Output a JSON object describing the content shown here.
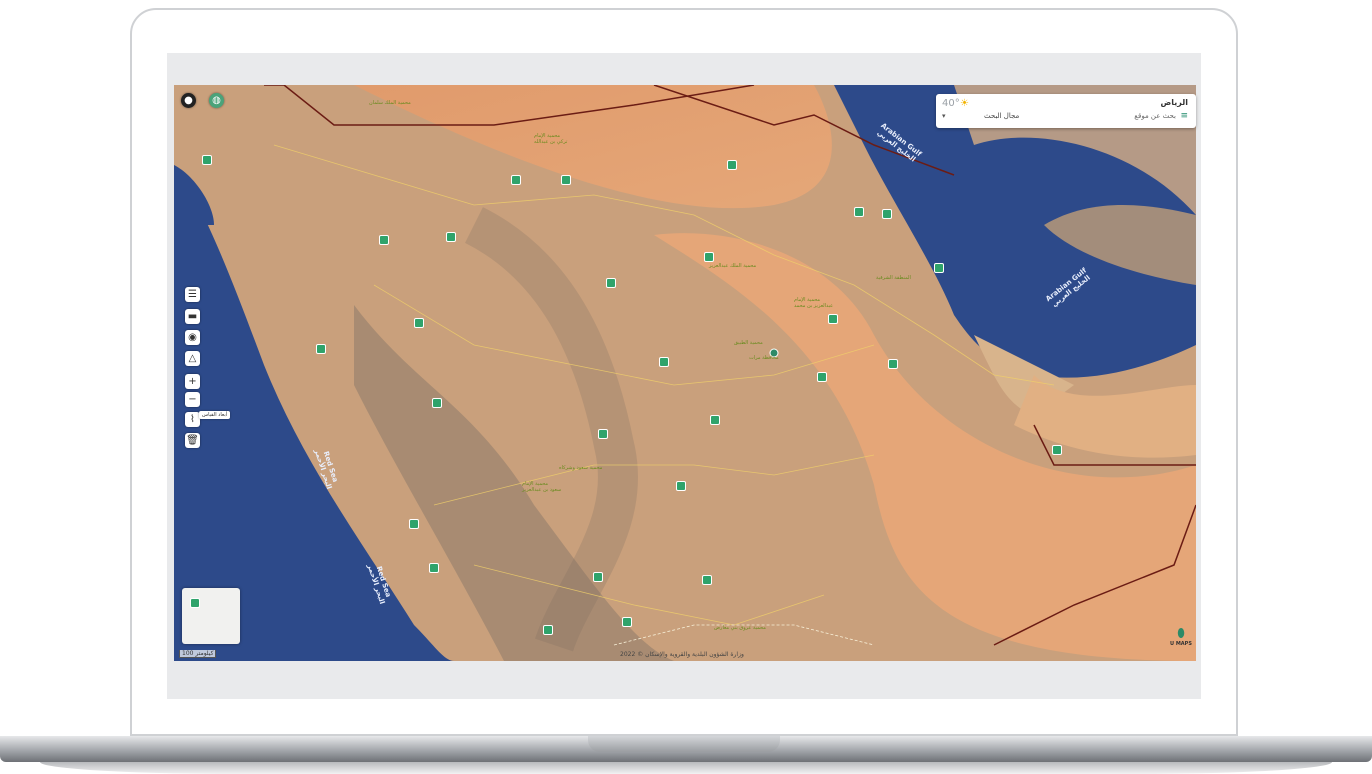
{
  "search_panel": {
    "temperature": "40°",
    "weather_icon": "sun-icon",
    "city": "الرياض",
    "search_hint": "بحث عن موقع",
    "search_scope": "مجال البحث"
  },
  "map": {
    "sea_labels": {
      "gulf_top": "Arabian Gulf\nالخليج العربي",
      "gulf_right": "Arabian Gulf\nالخليج العربي",
      "red_sea_mid": "Red Sea\nالبحر الأحمر",
      "red_sea_low": "Red Sea\nالبحر الأحمر"
    },
    "place_labels": {
      "p1": "محمية الملك سلمان",
      "p2": "محمية الإمام\nتركي بن عبدالله",
      "p3": "محمية الملك عبدالعزيز",
      "p4": "محمية الإمام\nعبدالعزيز بن محمد",
      "p5": "المنطقة الشرقية",
      "p6": "محمية الطبيق",
      "p7": "محافظة مرات",
      "p8": "محمية سعود وشركاه",
      "p9": "محمية الإمام\nسعود بن عبدالعزيز",
      "p10": "محمية عروق بني معارض"
    },
    "tooltip": "أبعاد القياس",
    "scale": "100 كيلومتر",
    "attribution": "وزارة الشؤون البلدية والقروية والإسكان © 2022",
    "logo_text": "U MAPS"
  },
  "colors": {
    "brand": "#2c8a67",
    "pin": "#2fa36b",
    "sea": "#2d4a8a",
    "desert": "#d9a77a"
  }
}
